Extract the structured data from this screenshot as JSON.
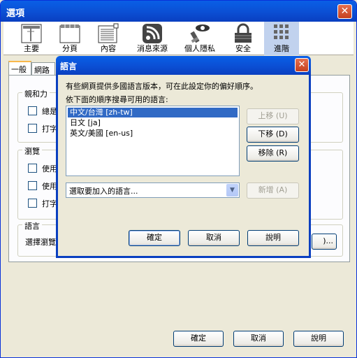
{
  "window": {
    "title": "選項",
    "close_glyph": "✕"
  },
  "toolbar": {
    "items": [
      {
        "label": "主要",
        "icon": "main-window-icon"
      },
      {
        "label": "分頁",
        "icon": "tabs-icon"
      },
      {
        "label": "內容",
        "icon": "content-icon"
      },
      {
        "label": "消息來源",
        "icon": "feed-icon"
      },
      {
        "label": "個人隱私",
        "icon": "privacy-mask-icon"
      },
      {
        "label": "安全",
        "icon": "security-lock-icon"
      },
      {
        "label": "進階",
        "icon": "advanced-gear-icon"
      }
    ],
    "active": "進階"
  },
  "tabs": {
    "general": "一般",
    "network": "網路"
  },
  "groups": {
    "accessibility": {
      "title": "親和力",
      "opt1": "總是",
      "opt2": "打字"
    },
    "browsing": {
      "title": "瀏覽",
      "opt1": "使用",
      "opt2": "使用",
      "opt3": "打字"
    },
    "language": {
      "title": "語言",
      "text": "選擇瀏覽",
      "choose_btn_tail": ")..."
    }
  },
  "main_buttons": {
    "ok": "確定",
    "cancel": "取消",
    "help": "說明"
  },
  "dialog": {
    "title": "語言",
    "close_glyph": "✕",
    "intro": "有些網頁提供多國語言版本，可在此設定你的偏好順序。",
    "list_label": "依下面的順序搜尋可用的語言:",
    "languages": [
      {
        "label": "中文/台灣  [zh-tw]",
        "selected": true
      },
      {
        "label": "日文  [ja]",
        "selected": false
      },
      {
        "label": "英文/美國  [en-us]",
        "selected": false
      }
    ],
    "move_up": "上移 (U)",
    "move_down": "下移 (D)",
    "remove": "移除 (R)",
    "add_select_placeholder": "選取要加入的語言...",
    "add": "新增 (A)",
    "ok": "確定",
    "cancel": "取消",
    "help": "說明"
  }
}
